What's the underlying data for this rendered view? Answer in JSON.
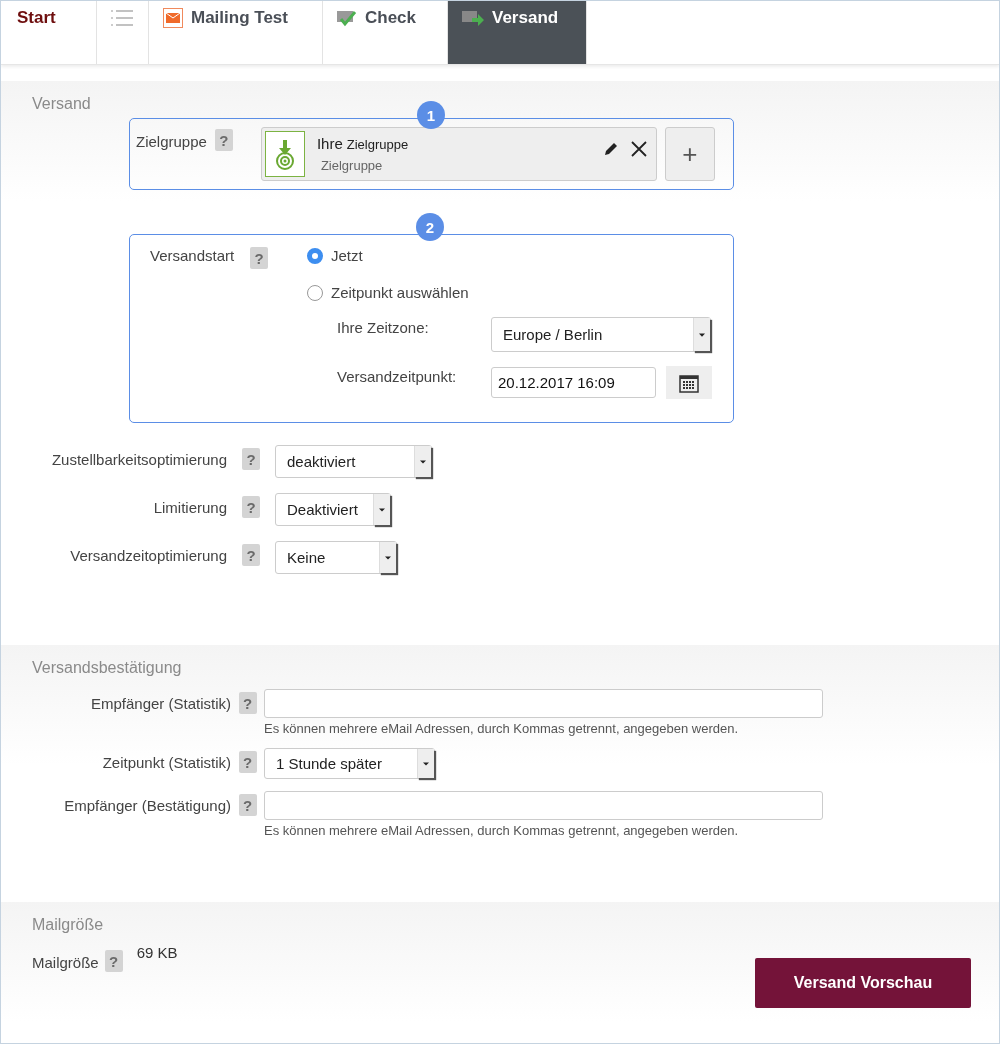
{
  "tabs": [
    {
      "kind": "text",
      "label": "Start",
      "selected": false
    },
    {
      "kind": "list",
      "selected": false
    },
    {
      "kind": "mail",
      "label": "Mailing Test",
      "selected": false
    },
    {
      "kind": "check",
      "label": "Check",
      "selected": false
    },
    {
      "kind": "send",
      "label": "Versand",
      "selected": true
    }
  ],
  "versand": {
    "title": "Versand",
    "target_group": {
      "step": "1",
      "label": "Zielgruppe",
      "help": "?",
      "group_title": "Ihre",
      "group_title_small": "Zielgruppe",
      "group_subtitle": "Zielgruppe",
      "add_button": "+"
    },
    "start": {
      "step": "2",
      "label": "Versandstart",
      "help": "?",
      "options": [
        {
          "label": "Jetzt",
          "selected": true
        },
        {
          "label": "Zeitpunkt auswählen",
          "selected": false
        }
      ],
      "timezone": {
        "label": "Ihre Zeitzone:",
        "value": "Europe / Berlin"
      },
      "send_time": {
        "label": "Versandzeitpunkt:",
        "value": "20.12.2017 16:09"
      }
    },
    "options": [
      {
        "label": "Zustellbarkeitsoptimierung",
        "help": "?",
        "value": "deaktiviert"
      },
      {
        "label": "Limitierung",
        "help": "?",
        "value": "Deaktiviert"
      },
      {
        "label": "Versandzeitoptimierung",
        "help": "?",
        "value": "Keine"
      }
    ]
  },
  "confirmation": {
    "title": "Versandsbestätigung",
    "fields": [
      {
        "kind": "input",
        "label": "Empfänger (Statistik)",
        "help": "?",
        "hint": "Es können mehrere eMail Adressen, durch Kommas getrennt, angegeben werden."
      },
      {
        "kind": "select",
        "label": "Zeitpunkt (Statistik)",
        "help": "?",
        "value": "1 Stunde später"
      },
      {
        "kind": "input",
        "label": "Empfänger (Bestätigung)",
        "help": "?",
        "hint": "Es können mehrere eMail Adressen, durch Kommas getrennt, angegeben werden."
      }
    ]
  },
  "mail_size": {
    "title": "Mailgröße",
    "label": "Mailgröße",
    "help": "?",
    "value": "69 KB"
  },
  "preview_button": "Versand Vorschau"
}
